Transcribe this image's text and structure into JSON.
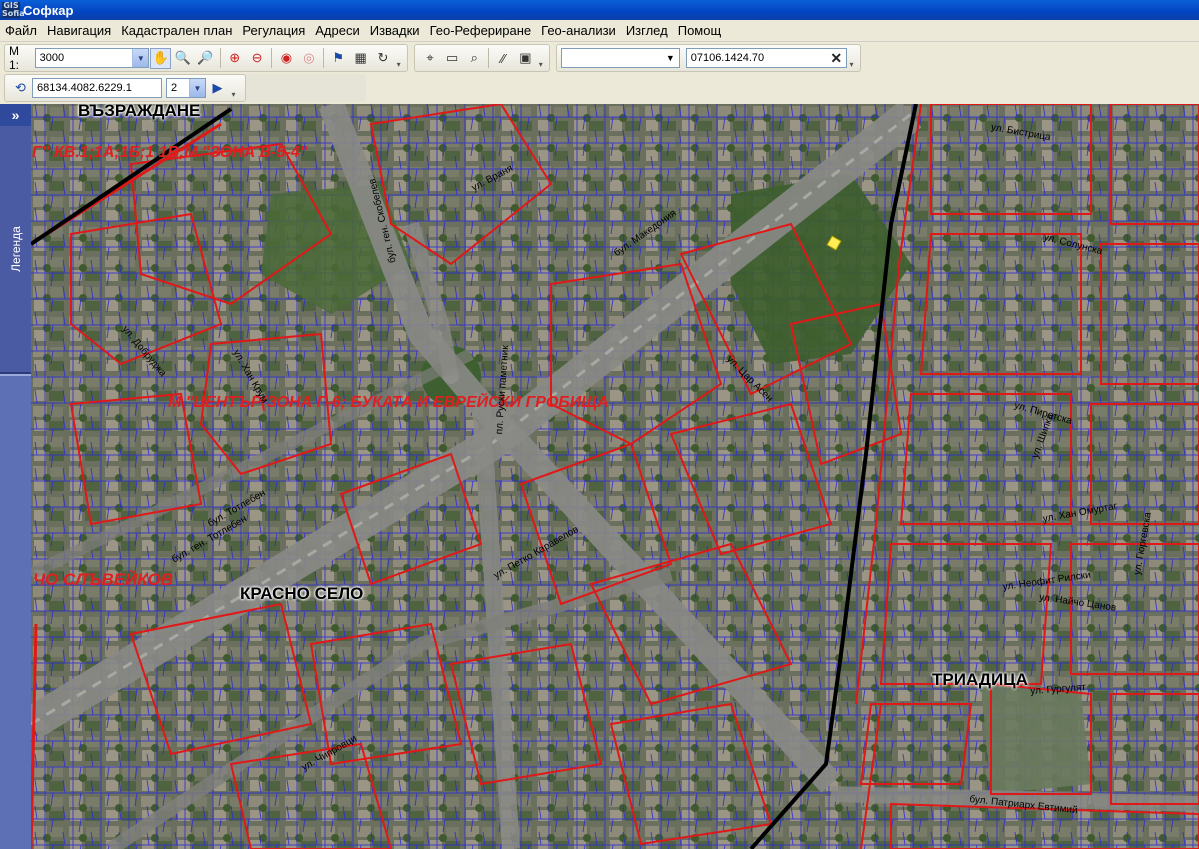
{
  "window": {
    "title": "Софкар",
    "icon_text": "GIS Sofia"
  },
  "menu": [
    "Файл",
    "Навигация",
    "Кадастрален план",
    "Регулация",
    "Адреси",
    "Извадки",
    "Гео-Рефериране",
    "Гео-анализи",
    "Изглед",
    "Помощ"
  ],
  "toolbar1": {
    "scale_label": "М 1:",
    "scale_value": "3000",
    "icons": [
      "pan-hand-icon",
      "zoom-in-icon",
      "zoom-out-icon",
      "zoom-in-red-icon",
      "zoom-out-red-icon",
      "zoom-previous-icon",
      "zoom-next-icon",
      "flag-icon",
      "grid-icon",
      "refresh-icon"
    ]
  },
  "toolbar2": {
    "icons": [
      "select-icon",
      "rectangle-icon",
      "measure-icon",
      "line-icon",
      "image-icon"
    ]
  },
  "toolbar3": {
    "combo_value": "",
    "parcel_id": "07106.1424.70",
    "clear_icon": "clear-x-icon"
  },
  "toolbar4": {
    "coords": "68134.4082.6229.1",
    "level_value": "2",
    "go_icon": "play-icon"
  },
  "sidebar": {
    "toggle": "»",
    "tab_label": "Легенда"
  },
  "map": {
    "districts": [
      "ВЪЗРАЖДАНЕ",
      "КРАСНО СЕЛО",
      "ТРИАДИЦА"
    ],
    "zones": [
      "Г\" КВ.1;1А;1Б;1 1В;М.\"ЗОНА В-5-4\"",
      "М.\"ЦЕНТЪР(ЗОНА Г-6; БУКАТА И ЕВРЕЙСКИ ГРОБИЩА",
      "ЧО СЛЪВЕЙКОВ"
    ],
    "streets": [
      "бул. ген. Скобелев",
      "ул. Враня",
      "бул. Македония",
      "ул. Бистрица",
      "ул. Солунска",
      "ул. Пиротска",
      "ул. Хан Омуртаг",
      "ул. Найчо Цанов",
      "ул. Гюргевска",
      "пл. Руски паметник",
      "бул. Тотлебен",
      "бул. ген. Тотлебен",
      "ул. Петко Каравелов",
      "ул. Цар Асен",
      "ул. Шипка",
      "ул. Чипровци",
      "бул. Патриарх Евтимий",
      "ул. Неофит Рилски",
      "ул. Хан Крум",
      "ул. Добруджа",
      "ул. Гургулят"
    ]
  }
}
